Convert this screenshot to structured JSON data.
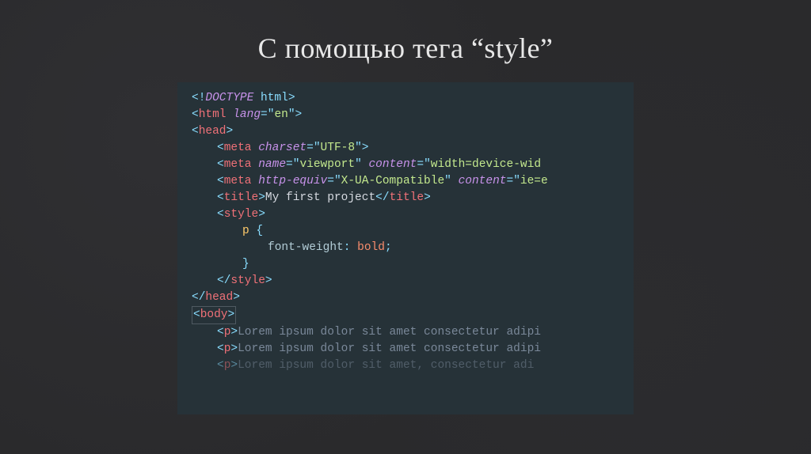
{
  "title": "С помощью тега “style”",
  "code": {
    "doctype_bang": "<!",
    "doctype_kw": "DOCTYPE",
    "doctype_html": " html",
    "angle_close": ">",
    "lt": "<",
    "lt_slash": "</",
    "gt": ">",
    "html_tag": "html",
    "html_attr_lang": "lang",
    "eq": "=",
    "q": "\"",
    "val_en": "en",
    "head_tag": "head",
    "meta_tag": "meta",
    "attr_charset": "charset",
    "val_utf8": "UTF-8",
    "attr_name": "name",
    "val_viewport": "viewport",
    "attr_content": "content",
    "val_viewport_content": "width=device-wid",
    "attr_httpequiv": "http-equiv",
    "val_xua": "X-UA-Compatible",
    "val_ie": "ie=e",
    "title_tag": "title",
    "title_text": "My first project",
    "style_tag": "style",
    "css_selector": "p",
    "css_brace_open": " {",
    "css_prop": "font-weight",
    "css_colon": ": ",
    "css_val": "bold",
    "css_semicolon": ";",
    "css_brace_close": "}",
    "body_tag": "body",
    "p_tag": "p",
    "lorem": "Lorem ipsum dolor sit amet consectetur adipi",
    "lorem_cut": "Lorem ipsum dolor sit amet, consectetur adi"
  }
}
